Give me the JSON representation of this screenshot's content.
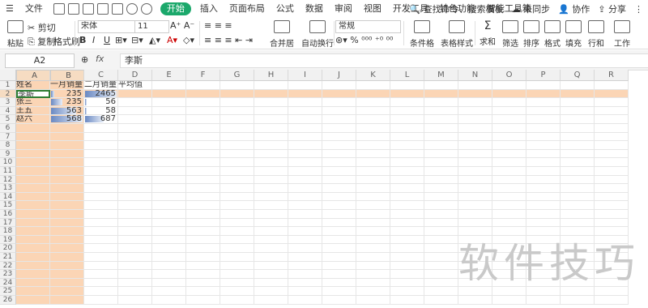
{
  "menubar": {
    "file": "文件",
    "tabs": [
      "开始",
      "插入",
      "页面布局",
      "公式",
      "数据",
      "审阅",
      "视图",
      "开发工具",
      "特色功能",
      "智能工具箱"
    ],
    "active_tab": "开始",
    "search": "查找命令、搜索模板",
    "sync": "未同步",
    "collab": "协作",
    "share": "分享"
  },
  "ribbon": {
    "paste": "粘贴",
    "cut": "剪切",
    "copy": "复制",
    "format_painter": "格式刷",
    "font_name": "宋体",
    "font_size": "11",
    "merge_center": "合并居中",
    "wrap": "自动换行",
    "number_format": "常规",
    "cond_format": "条件格式",
    "table_style": "表格样式",
    "sum": "求和",
    "filter": "筛选",
    "sort": "排序",
    "format": "格式",
    "fill": "填充",
    "rows_cols": "行和列",
    "worksheet": "工作表"
  },
  "formula_bar": {
    "name_box": "A2",
    "fx": "fx",
    "content": "李斯"
  },
  "sheet": {
    "columns": [
      "A",
      "B",
      "C",
      "D",
      "E",
      "F",
      "G",
      "H",
      "I",
      "J",
      "K",
      "L",
      "M",
      "N",
      "O",
      "P",
      "Q",
      "R"
    ],
    "rows": [
      "1",
      "2",
      "3",
      "4",
      "5",
      "6",
      "7",
      "8",
      "9",
      "10",
      "11",
      "12",
      "13",
      "14",
      "15",
      "16",
      "17",
      "18",
      "19",
      "20",
      "21",
      "22",
      "23",
      "24",
      "25",
      "26"
    ],
    "headers": [
      "姓名",
      "一月销量",
      "二月销量",
      "平均值"
    ],
    "data": [
      {
        "name": "李斯",
        "jan": "235",
        "feb": "2465",
        "jan_bar": 0.1,
        "feb_bar": 1.0
      },
      {
        "name": "张三",
        "jan": "235",
        "feb": "56",
        "jan_bar": 0.35,
        "feb_bar": 0.03
      },
      {
        "name": "王五",
        "jan": "563",
        "feb": "58",
        "jan_bar": 0.8,
        "feb_bar": 0.04
      },
      {
        "name": "赵六",
        "jan": "568",
        "feb": "687",
        "jan_bar": 1.0,
        "feb_bar": 0.6
      }
    ]
  },
  "watermark": "软件技巧",
  "colors": {
    "accent": "#1ba86b",
    "selection": "#fbd5b5",
    "databar": "#6a89c3"
  }
}
